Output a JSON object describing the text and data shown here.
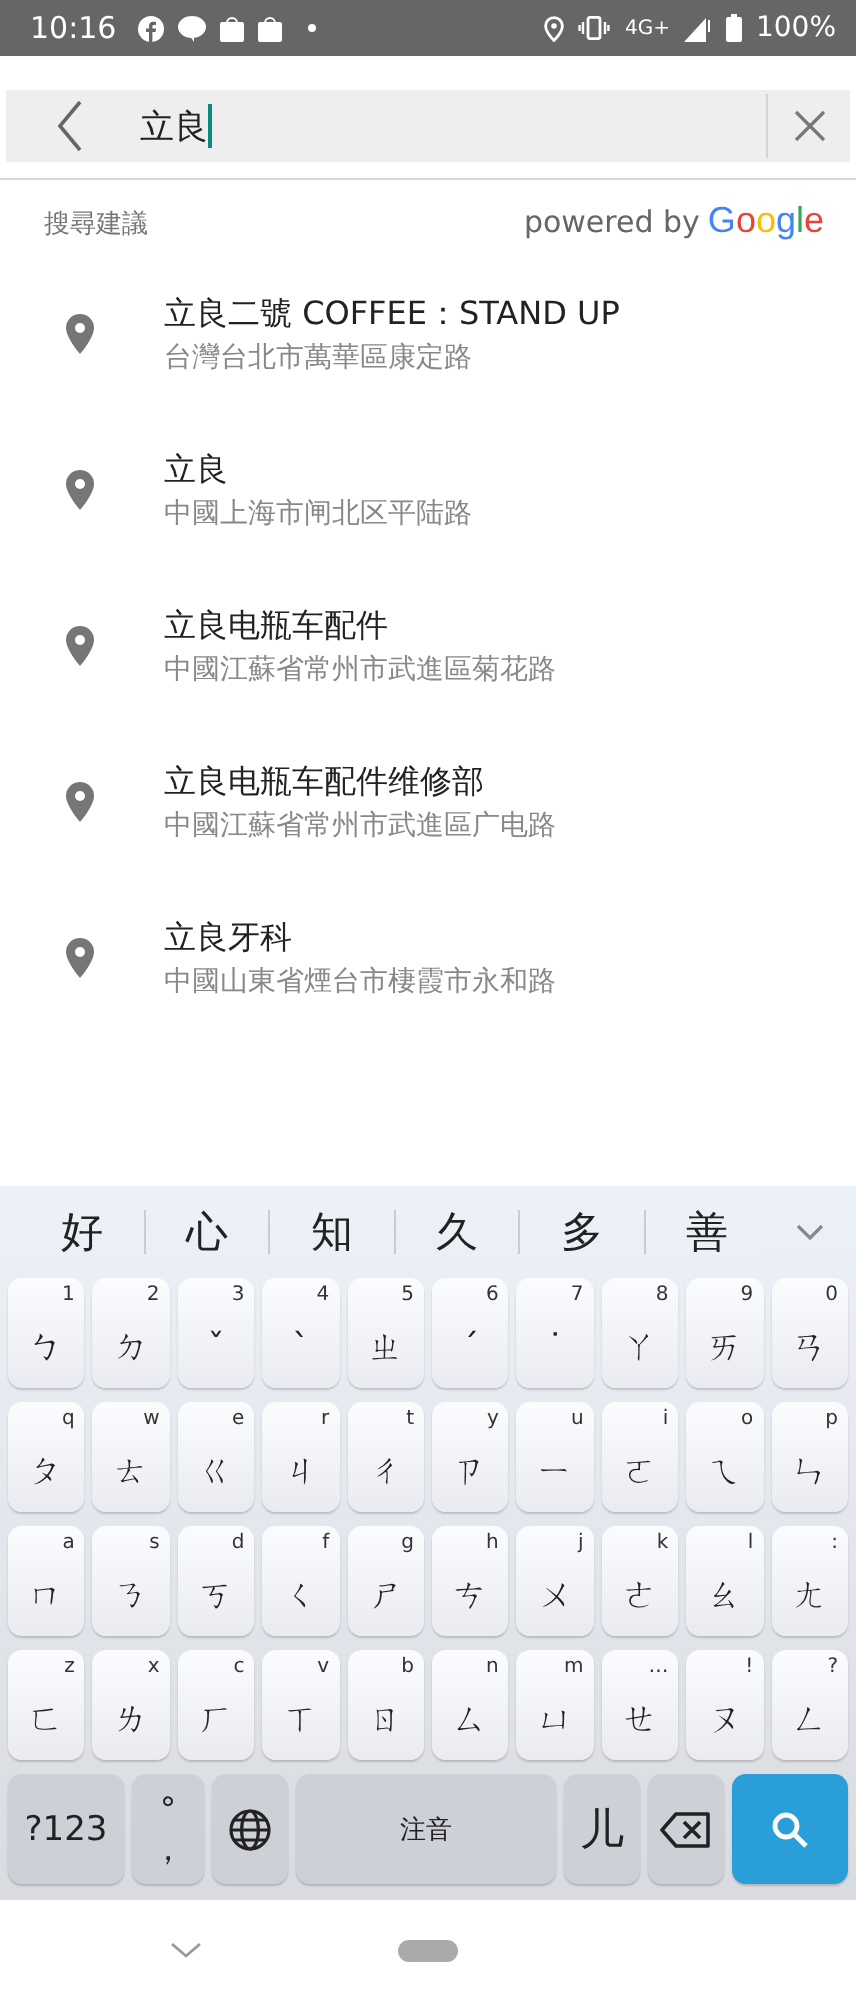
{
  "status_bar": {
    "time": "10:16",
    "network": "4G+",
    "battery": "100%"
  },
  "search": {
    "value": "立良"
  },
  "suggestions_header": {
    "label": "搜尋建議",
    "powered_by": "powered by",
    "logo": "Google"
  },
  "results": [
    {
      "title": "立良二號 COFFEE：STAND UP",
      "address": "台灣台北市萬華區康定路"
    },
    {
      "title": "立良",
      "address": "中國上海市闸北区平陆路"
    },
    {
      "title": "立良电瓶车配件",
      "address": "中國江蘇省常州市武進區菊花路"
    },
    {
      "title": "立良电瓶车配件维修部",
      "address": "中國江蘇省常州市武進區广电路"
    },
    {
      "title": "立良牙科",
      "address": "中國山東省煙台市棲霞市永和路"
    }
  ],
  "keyboard": {
    "candidates": [
      "好",
      "心",
      "知",
      "久",
      "多",
      "善"
    ],
    "rows": [
      [
        {
          "label": "ㄅ",
          "hint": "1"
        },
        {
          "label": "ㄉ",
          "hint": "2"
        },
        {
          "label": "ˇ",
          "hint": "3"
        },
        {
          "label": "ˋ",
          "hint": "4"
        },
        {
          "label": "ㄓ",
          "hint": "5"
        },
        {
          "label": "ˊ",
          "hint": "6"
        },
        {
          "label": "˙",
          "hint": "7"
        },
        {
          "label": "ㄚ",
          "hint": "8"
        },
        {
          "label": "ㄞ",
          "hint": "9"
        },
        {
          "label": "ㄢ",
          "hint": "0"
        }
      ],
      [
        {
          "label": "ㄆ",
          "hint": "q"
        },
        {
          "label": "ㄊ",
          "hint": "w"
        },
        {
          "label": "ㄍ",
          "hint": "e"
        },
        {
          "label": "ㄐ",
          "hint": "r"
        },
        {
          "label": "ㄔ",
          "hint": "t"
        },
        {
          "label": "ㄗ",
          "hint": "y"
        },
        {
          "label": "ㄧ",
          "hint": "u"
        },
        {
          "label": "ㄛ",
          "hint": "i"
        },
        {
          "label": "ㄟ",
          "hint": "o"
        },
        {
          "label": "ㄣ",
          "hint": "p"
        }
      ],
      [
        {
          "label": "ㄇ",
          "hint": "a"
        },
        {
          "label": "ㄋ",
          "hint": "s"
        },
        {
          "label": "ㄎ",
          "hint": "d"
        },
        {
          "label": "ㄑ",
          "hint": "f"
        },
        {
          "label": "ㄕ",
          "hint": "g"
        },
        {
          "label": "ㄘ",
          "hint": "h"
        },
        {
          "label": "ㄨ",
          "hint": "j"
        },
        {
          "label": "ㄜ",
          "hint": "k"
        },
        {
          "label": "ㄠ",
          "hint": "l"
        },
        {
          "label": "ㄤ",
          "hint": ":"
        }
      ],
      [
        {
          "label": "ㄈ",
          "hint": "z"
        },
        {
          "label": "ㄌ",
          "hint": "x"
        },
        {
          "label": "ㄏ",
          "hint": "c"
        },
        {
          "label": "ㄒ",
          "hint": "v"
        },
        {
          "label": "ㄖ",
          "hint": "b"
        },
        {
          "label": "ㄙ",
          "hint": "n"
        },
        {
          "label": "ㄩ",
          "hint": "m"
        },
        {
          "label": "ㄝ",
          "hint": "…"
        },
        {
          "label": "ㄡ",
          "hint": "!"
        },
        {
          "label": "ㄥ",
          "hint": "?"
        }
      ]
    ],
    "bottom_row": [
      {
        "kind": "symbols",
        "label": "?123"
      },
      {
        "kind": "punct",
        "label": "°",
        "label2": "，"
      },
      {
        "kind": "globe"
      },
      {
        "kind": "space",
        "label": "注音"
      },
      {
        "kind": "key",
        "label": "儿"
      },
      {
        "kind": "backspace"
      },
      {
        "kind": "search"
      }
    ]
  }
}
